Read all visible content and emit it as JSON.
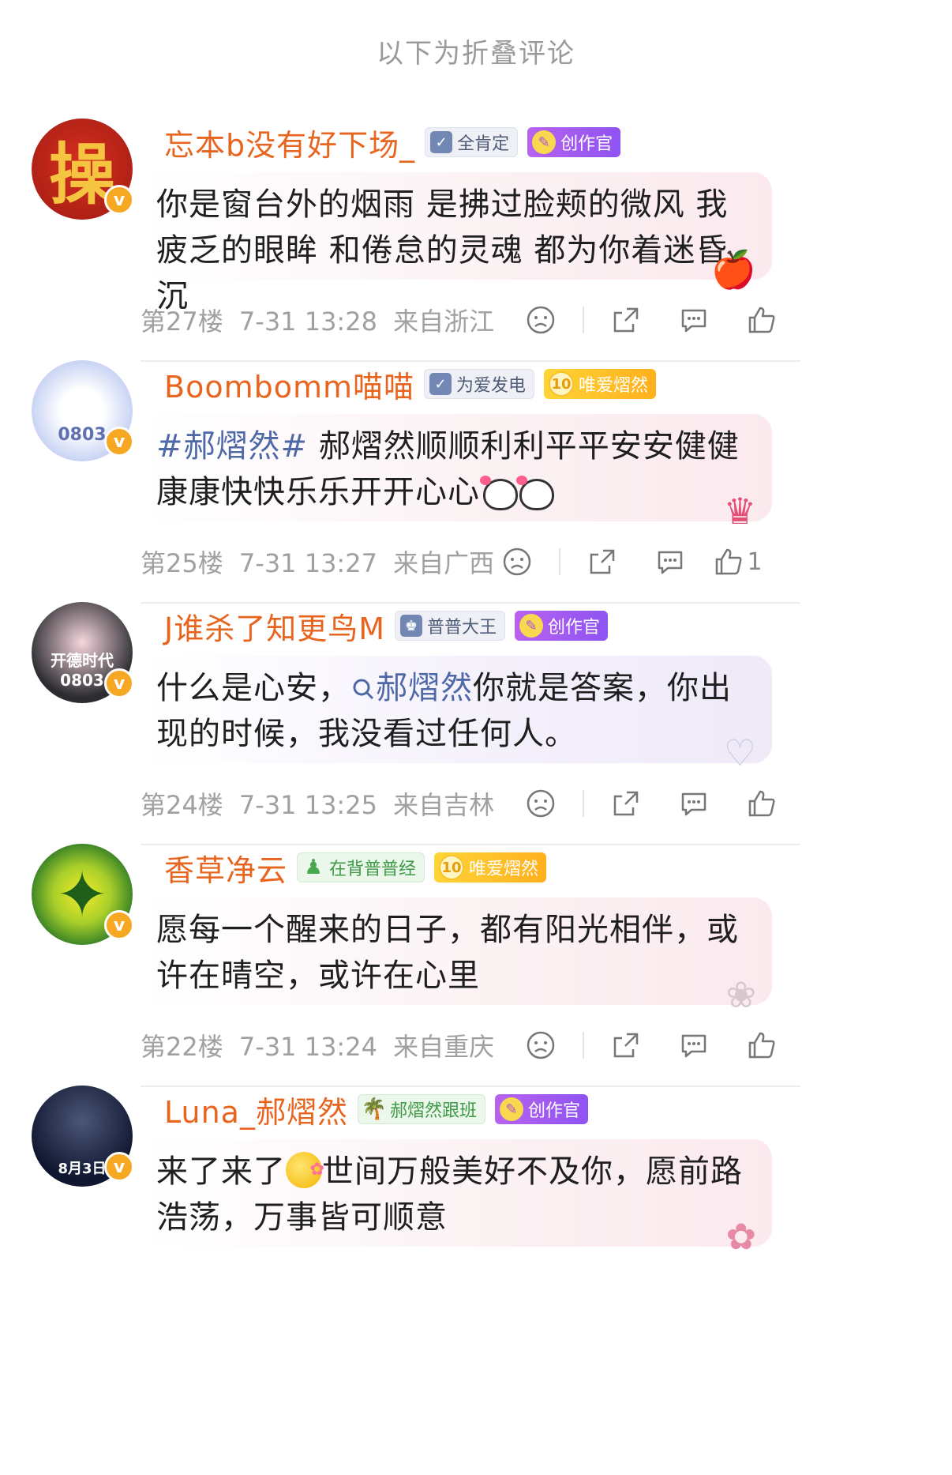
{
  "folded_header": "以下为折叠评论",
  "comments": [
    {
      "username": "忘本b没有好下场_",
      "avatar_text": "操",
      "avatar_color": "#c7251c",
      "badges": [
        {
          "label": "全肯定",
          "type": "fan",
          "icon": "calendar-check-icon"
        },
        {
          "label": "创作官",
          "type": "creator",
          "icon": "creator-icon"
        }
      ],
      "text": "你是窗台外的烟雨 是拂过脸颊的微风 我疲乏的眼眸 和倦怠的灵魂 都为你着迷昏沉",
      "floor": "第27楼",
      "time": "7-31 13:28",
      "location": "来自浙江",
      "likes": ""
    },
    {
      "username": "Boombomm喵喵",
      "avatar_text": "0803",
      "avatar_color": "#b7c6f0",
      "badges": [
        {
          "label": "为爱发电",
          "type": "fan",
          "icon": "calendar-check-icon"
        },
        {
          "label": "唯爱熠然",
          "type": "superfan",
          "icon": "level-10-icon",
          "level": "10"
        }
      ],
      "topic": "#郝熠然#",
      "text": " 郝熠然顺顺利利平平安安健健康康快快乐乐开开心心",
      "floor": "第25楼",
      "time": "7-31 13:27",
      "location": "来自广西",
      "likes": "1"
    },
    {
      "username": "J谁杀了知更鸟M",
      "avatar_text": "开德时代 0803",
      "avatar_color": "#2b2b30",
      "badges": [
        {
          "label": "普普大王",
          "type": "fan",
          "icon": "crown-icon"
        },
        {
          "label": "创作官",
          "type": "creator",
          "icon": "creator-icon"
        }
      ],
      "text_before": "什么是心安，",
      "search_term": "郝熠然",
      "text_after": "你就是答案，你出现的时候，我没看过任何人。",
      "floor": "第24楼",
      "time": "7-31 13:25",
      "location": "来自吉林",
      "likes": ""
    },
    {
      "username": "香草净云",
      "avatar_text": "✦",
      "avatar_color": "#2f7c26",
      "badges": [
        {
          "label": "在背普普经",
          "type": "green",
          "icon": "reading-person-icon"
        },
        {
          "label": "唯爱熠然",
          "type": "superfan",
          "icon": "level-10-icon",
          "level": "10"
        }
      ],
      "text": "愿每一个醒来的日子，都有阳光相伴，或许在晴空，或许在心里",
      "floor": "第22楼",
      "time": "7-31 13:24",
      "location": "来自重庆",
      "likes": ""
    },
    {
      "username": "Luna_郝熠然",
      "avatar_text": "8月3日",
      "avatar_color": "#0f1730",
      "badges": [
        {
          "label": "郝熠然跟班",
          "type": "green",
          "icon": "palm-tree-icon"
        },
        {
          "label": "创作官",
          "type": "creator",
          "icon": "creator-icon"
        }
      ],
      "text_before": "来了来了",
      "text_after": "世间万般美好不及你，愿前路浩荡，万事皆可顺意",
      "floor": "",
      "time": "",
      "location": "",
      "likes": ""
    }
  ]
}
